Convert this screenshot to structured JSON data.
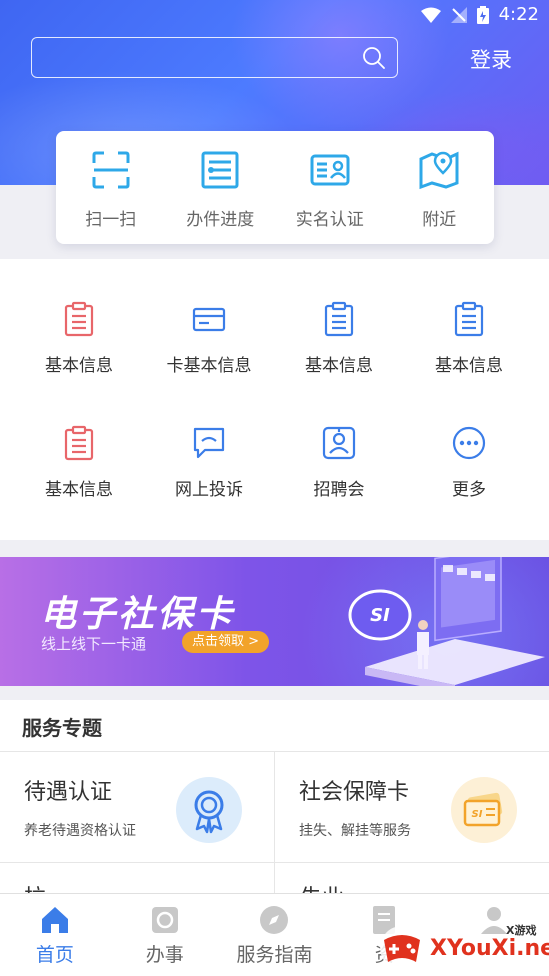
{
  "status_bar": {
    "time": "4:22"
  },
  "header": {
    "login_label": "登录",
    "search": {
      "placeholder": ""
    }
  },
  "quick_actions": [
    {
      "label": "扫一扫",
      "icon": "scan-icon"
    },
    {
      "label": "办件进度",
      "icon": "progress-list-icon"
    },
    {
      "label": "实名认证",
      "icon": "id-card-icon"
    },
    {
      "label": "附近",
      "icon": "map-pin-icon"
    }
  ],
  "function_grid": {
    "row1": [
      {
        "label": "基本信息",
        "icon": "clipboard-icon",
        "color": "#e8666a"
      },
      {
        "label": "卡基本信息",
        "icon": "card-icon",
        "color": "#3b7de8"
      },
      {
        "label": "基本信息",
        "icon": "clipboard-icon",
        "color": "#3b7de8"
      },
      {
        "label": "基本信息",
        "icon": "clipboard-icon",
        "color": "#3b7de8"
      }
    ],
    "row2": [
      {
        "label": "基本信息",
        "icon": "clipboard-icon",
        "color": "#e8666a"
      },
      {
        "label": "网上投诉",
        "icon": "chat-bubble-icon",
        "color": "#3b7de8"
      },
      {
        "label": "招聘会",
        "icon": "person-frame-icon",
        "color": "#3b7de8"
      },
      {
        "label": "更多",
        "icon": "more-dots-icon",
        "color": "#3b7de8"
      }
    ]
  },
  "banner": {
    "title": "电子社保卡",
    "subtitle": "线上线下一卡通",
    "button_label": "点击领取 >",
    "card_badge": "SI"
  },
  "service_topics": {
    "header": "服务专题",
    "cards": [
      {
        "title": "待遇认证",
        "desc": "养老待遇资格认证",
        "icon": "medal-icon",
        "icon_bg": "#dcecfb"
      },
      {
        "title": "社会保障卡",
        "desc": "挂失、解挂等服务",
        "icon": "social-card-icon",
        "icon_bg": "#fdf0d6"
      }
    ],
    "peek": [
      "拉...",
      "失业..."
    ]
  },
  "bottom_nav": [
    {
      "label": "首页",
      "icon": "home-icon",
      "active": true
    },
    {
      "label": "办事",
      "icon": "affairs-icon",
      "active": false
    },
    {
      "label": "服务指南",
      "icon": "compass-icon",
      "active": false
    },
    {
      "label": "资",
      "icon": "document-icon",
      "active": false
    },
    {
      "label": "",
      "icon": "user-icon",
      "active": false
    }
  ],
  "watermark": {
    "site": "XYouXi.net",
    "tag": "X游戏"
  },
  "colors": {
    "primary": "#3b7de8",
    "accent_red": "#e8666a",
    "banner_button": "#f2a32a"
  }
}
